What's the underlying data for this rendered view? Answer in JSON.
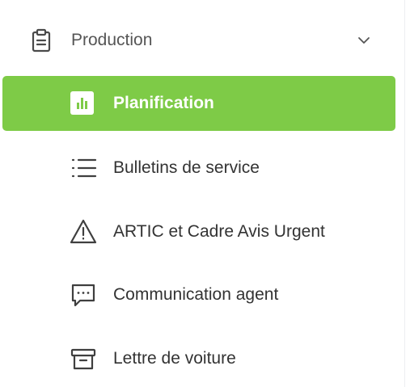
{
  "theme": {
    "accent": "#7ecb47",
    "text": "#333333"
  },
  "sidebar": {
    "section": {
      "label": "Production",
      "icon": "clipboard-icon",
      "expanded": true,
      "toggle_icon": "chevron-down-icon"
    },
    "items": [
      {
        "label": "Planification",
        "icon": "bar-chart-icon",
        "active": true
      },
      {
        "label": "Bulletins de service",
        "icon": "list-icon",
        "active": false
      },
      {
        "label": "ARTIC et Cadre Avis Urgent",
        "icon": "warning-triangle-icon",
        "active": false
      },
      {
        "label": "Communication agent",
        "icon": "message-dots-icon",
        "active": false
      },
      {
        "label": "Lettre de voiture",
        "icon": "archive-box-icon",
        "active": false
      }
    ]
  }
}
